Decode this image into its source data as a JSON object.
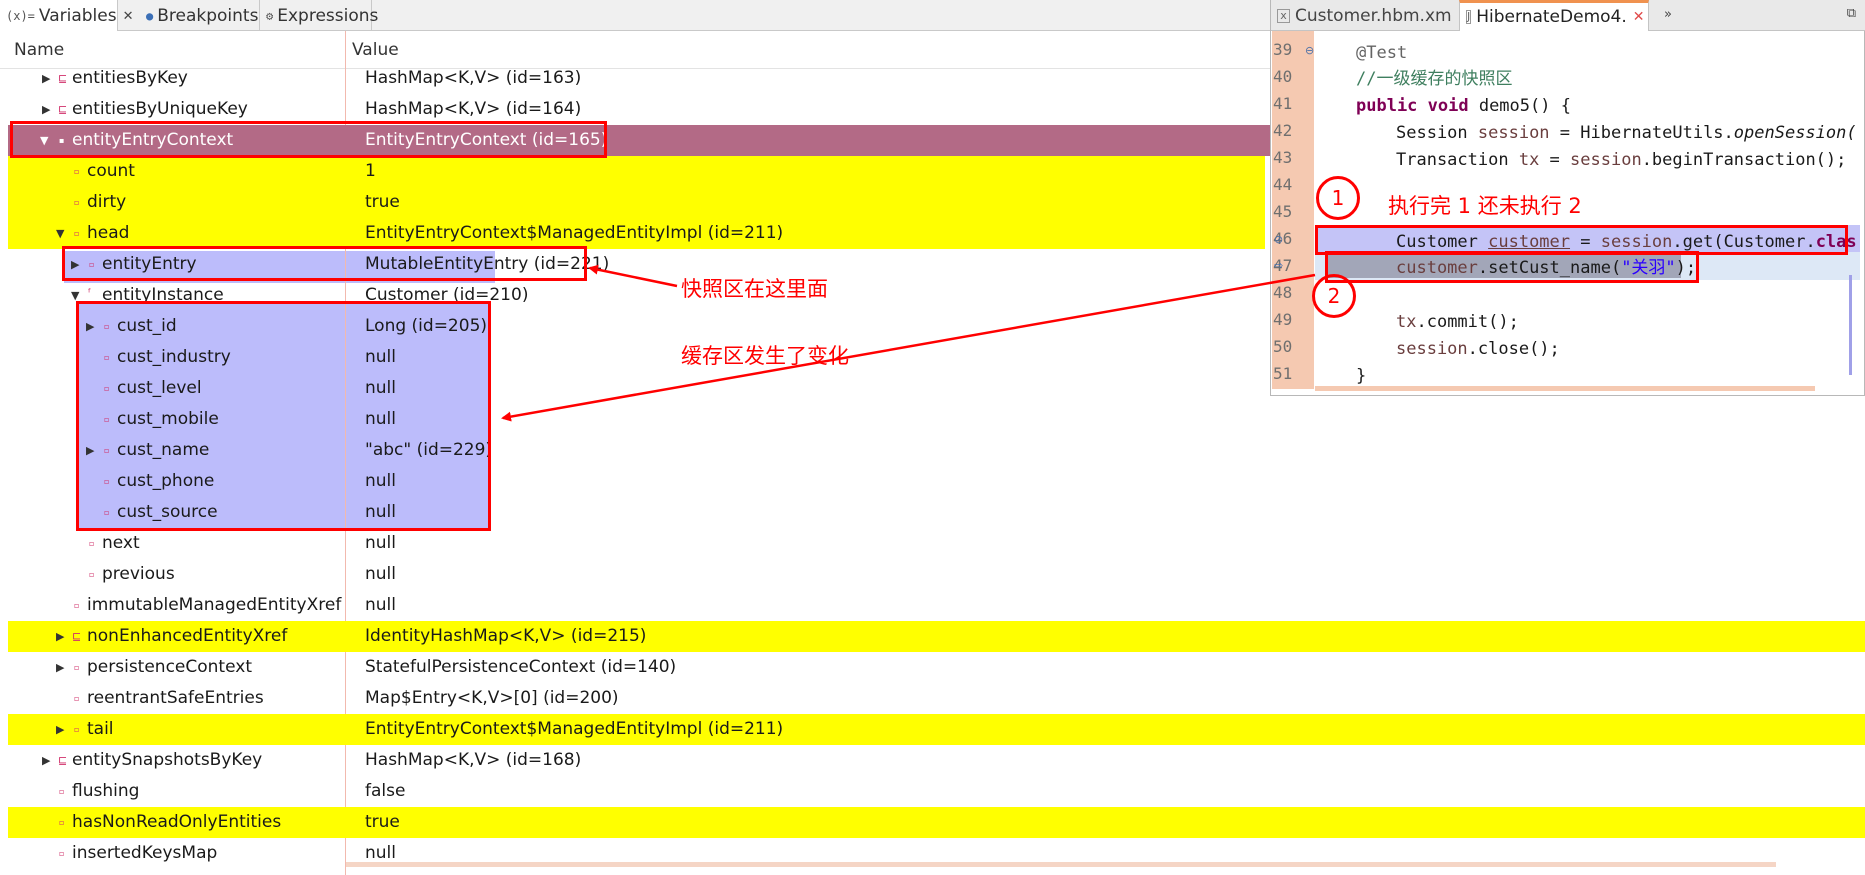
{
  "tabs": [
    {
      "icon": "(x)=",
      "label": "Variables",
      "close": "✕"
    },
    {
      "icon": "●",
      "label": "Breakpoints"
    },
    {
      "icon": "⚙",
      "label": "Expressions"
    }
  ],
  "columns": {
    "name": "Name",
    "value": "Value"
  },
  "rows": [
    {
      "name": "entitiesByKey",
      "value": "HashMap<K,V>  (id=163)"
    },
    {
      "name": "entitiesByUniqueKey",
      "value": "HashMap<K,V>  (id=164)"
    },
    {
      "name": "entityEntryContext",
      "value": "EntityEntryContext  (id=165)"
    },
    {
      "name": "count",
      "value": "1"
    },
    {
      "name": "dirty",
      "value": "true"
    },
    {
      "name": "head",
      "value": "EntityEntryContext$ManagedEntityImpl  (id=211)"
    },
    {
      "name": "entityEntry",
      "value": "MutableEntityEntry  (id=221)"
    },
    {
      "name": "entityInstance",
      "value": "Customer  (id=210)"
    },
    {
      "name": "cust_id",
      "value": "Long  (id=205)"
    },
    {
      "name": "cust_industry",
      "value": "null"
    },
    {
      "name": "cust_level",
      "value": "null"
    },
    {
      "name": "cust_mobile",
      "value": "null"
    },
    {
      "name": "cust_name",
      "value": "\"abc\" (id=229)"
    },
    {
      "name": "cust_phone",
      "value": "null"
    },
    {
      "name": "cust_source",
      "value": "null"
    },
    {
      "name": "next",
      "value": "null"
    },
    {
      "name": "previous",
      "value": "null"
    },
    {
      "name": "immutableManagedEntityXref",
      "value": "null"
    },
    {
      "name": "nonEnhancedEntityXref",
      "value": "IdentityHashMap<K,V>  (id=215)"
    },
    {
      "name": "persistenceContext",
      "value": "StatefulPersistenceContext  (id=140)"
    },
    {
      "name": "reentrantSafeEntries",
      "value": "Map$Entry<K,V>[0]  (id=200)"
    },
    {
      "name": "tail",
      "value": "EntityEntryContext$ManagedEntityImpl  (id=211)"
    },
    {
      "name": "entitySnapshotsByKey",
      "value": "HashMap<K,V>  (id=168)"
    },
    {
      "name": "flushing",
      "value": "false"
    },
    {
      "name": "hasNonReadOnlyEntities",
      "value": "true"
    },
    {
      "name": "insertedKeysMap",
      "value": "null"
    }
  ],
  "annotations": {
    "snapshot": "快照区在这里面",
    "cache": "缓存区发生了变化",
    "step": "执行完 1 还未执行 2",
    "circle1": "1",
    "circle2": "2"
  },
  "editor": {
    "tabs": [
      {
        "label": "Customer.hbm.xm"
      },
      {
        "label": "HibernateDemo4.",
        "close": "✕"
      }
    ],
    "overflow": "»",
    "maximize": "⧉",
    "line_numbers": [
      "39",
      "40",
      "41",
      "42",
      "43",
      "44",
      "45",
      "46",
      "47",
      "48",
      "49",
      "50",
      "51"
    ],
    "code": {
      "l39": "@Test",
      "l40": "//一级缓存的快照区",
      "l41_kw": "public void",
      "l41_rest": " demo5() {",
      "l42_a": "Session ",
      "l42_var": "session",
      "l42_b": " = HibernateUtils.",
      "l42_it": "openSession(",
      "l43_a": "Transaction ",
      "l43_var": "tx",
      "l43_b": " = ",
      "l43_var2": "session",
      "l43_c": ".beginTransaction();",
      "l46_a": "Customer ",
      "l46_var": "customer",
      "l46_b": " = ",
      "l46_var2": "session",
      "l46_c": ".get(Customer.",
      "l46_kw": "clas",
      "l47_var": "customer",
      "l47_a": ".setCust_name(",
      "l47_str": "\"关羽\"",
      "l47_b": ");",
      "l49_var": "tx",
      "l49_a": ".commit();",
      "l50_var": "session",
      "l50_a": ".close();",
      "l51": "}"
    }
  },
  "colors": {
    "selection_row": "#b36a86",
    "selection_row_right": "#f07c48",
    "changed_value": "#ffff00",
    "instance_highlight": "#bcbcfb",
    "annotation": "#ff0000"
  }
}
